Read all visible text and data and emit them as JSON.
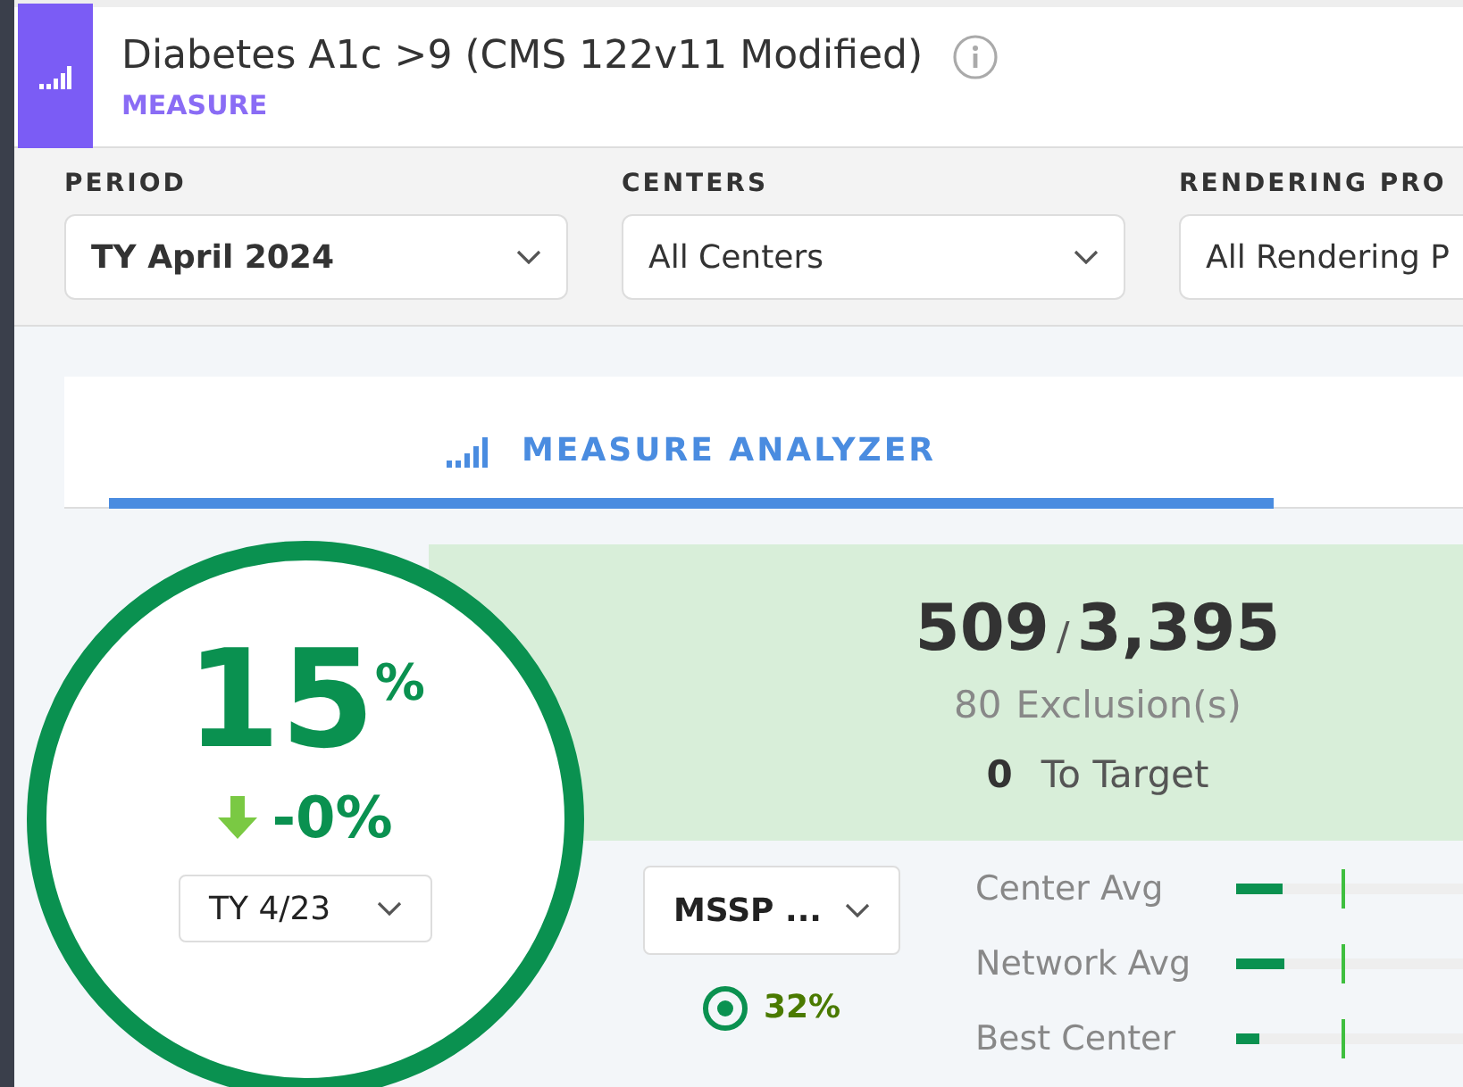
{
  "header": {
    "title": "Diabetes A1c >9 (CMS 122v11 Modified)",
    "subtitle": "MEASURE"
  },
  "filters": [
    {
      "label": "PERIOD",
      "value": "TY April 2024",
      "bold": true
    },
    {
      "label": "CENTERS",
      "value": "All Centers",
      "bold": false
    },
    {
      "label": "RENDERING PRO",
      "value": "All Rendering P",
      "bold": false
    }
  ],
  "tabs": [
    {
      "label": "MEASURE ANALYZER",
      "selected": true
    }
  ],
  "score": {
    "value": "15",
    "unit": "%",
    "change": "-0%",
    "compare_period": "TY 4/23"
  },
  "summary": {
    "numerator": "509",
    "separator": "/",
    "denominator": "3,395",
    "exclusions_count": "80",
    "exclusions_label": "Exclusion(s)",
    "to_target_count": "0",
    "to_target_label": "To Target"
  },
  "benchmark": {
    "program": "MSSP ...",
    "target": "32%"
  },
  "comparisons": [
    {
      "label": "Center Avg",
      "level": 0.2,
      "marker": {
        "level": 0.45
      }
    },
    {
      "label": "Network Avg",
      "level": 0.21,
      "marker": {
        "level": 0.45
      }
    },
    {
      "label": "Best Center",
      "level": 0.1,
      "marker": {
        "level": 0.45
      }
    }
  ]
}
